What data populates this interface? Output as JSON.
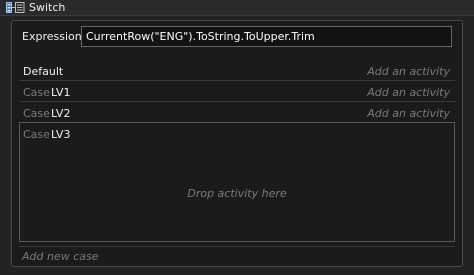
{
  "window": {
    "title": "Switch",
    "icon": "switch-activity-icon"
  },
  "expression": {
    "label": "Expression",
    "value": "CurrentRow(\"ENG\").ToString.ToUpper.Trim"
  },
  "default_row": {
    "label": "Default",
    "action": "Add an activity"
  },
  "cases": [
    {
      "prefix": "Case",
      "value": "LV1",
      "action": "Add an activity"
    },
    {
      "prefix": "Case",
      "value": "LV2",
      "action": "Add an activity"
    },
    {
      "prefix": "Case",
      "value": "LV3",
      "drop_hint": "Drop activity here"
    }
  ],
  "footer": {
    "add_case": "Add new case"
  },
  "colors": {
    "background": "#1e1e1e",
    "panel": "#1b1b1b",
    "text": "#f0f0f0",
    "muted": "#7a7a7a",
    "border": "#4a4a4a"
  }
}
